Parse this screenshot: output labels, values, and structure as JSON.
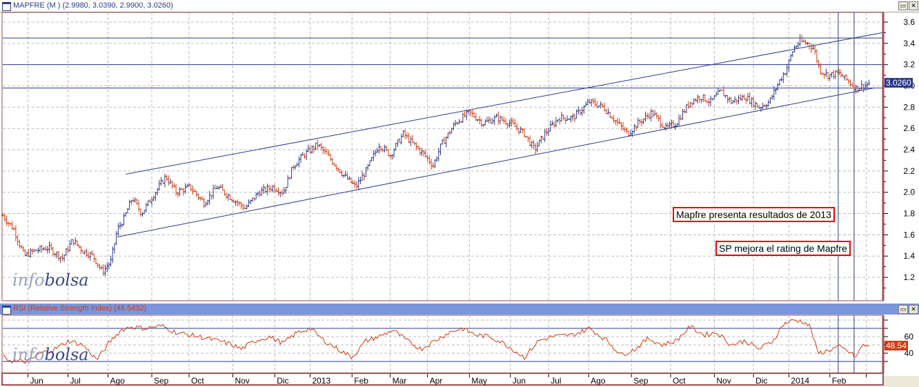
{
  "main_panel": {
    "title": "MAPFRE (M ) (2.9980, 3.0390, 2.9900, 3.0260)",
    "last_price_label": "3.0260",
    "watermark_a": "info",
    "watermark_b": "bolsa"
  },
  "rsi_panel": {
    "title": "RSI (Relative Strength Index) (48.5432)",
    "last_value_label": "48.54"
  },
  "annotations": [
    "Mapfre presenta resultados de 2013",
    "SP mejora el rating de Mapfre"
  ],
  "colors": {
    "up": "#2a3a8c",
    "down": "#d03a10",
    "lines": "#2a3a8c",
    "rsi": "#d03a10",
    "rsi_header": "#7b96dc"
  },
  "chart_data": [
    {
      "type": "line",
      "title": "MAPFRE (M )",
      "ohlc_last": {
        "open": 2.998,
        "high": 3.039,
        "low": 2.99,
        "close": 3.026
      },
      "x_unit": "weeks",
      "ylim": [
        1.1,
        3.7
      ],
      "y_ticks": [
        1.2,
        1.4,
        1.6,
        1.8,
        2.0,
        2.2,
        2.4,
        2.6,
        2.8,
        3.0,
        3.2,
        3.4,
        3.6
      ],
      "x_ticks": [
        {
          "label": "Jun",
          "x": 2.7
        },
        {
          "label": "Jul",
          "x": 7
        },
        {
          "label": "Ago",
          "x": 11.3
        },
        {
          "label": "Sep",
          "x": 16
        },
        {
          "label": "Oct",
          "x": 20
        },
        {
          "label": "Nov",
          "x": 24.7
        },
        {
          "label": "Dic",
          "x": 29.2
        },
        {
          "label": "2013",
          "x": 33
        },
        {
          "label": "Feb",
          "x": 37.5
        },
        {
          "label": "Mar",
          "x": 41.6
        },
        {
          "label": "Apr",
          "x": 45.6
        },
        {
          "label": "May",
          "x": 50.1
        },
        {
          "label": "Jun",
          "x": 54.5
        },
        {
          "label": "Jul",
          "x": 58.6
        },
        {
          "label": "Ago",
          "x": 62.9
        },
        {
          "label": "Sep",
          "x": 67.5
        },
        {
          "label": "Oct",
          "x": 71.7
        },
        {
          "label": "Nov",
          "x": 76.4
        },
        {
          "label": "Dic",
          "x": 80.6
        },
        {
          "label": "2014",
          "x": 84.4
        },
        {
          "label": "Feb",
          "x": 88.8
        },
        {
          "label": "",
          "x": 92.7
        }
      ],
      "close": [
        [
          0,
          1.78
        ],
        [
          1.2,
          1.65
        ],
        [
          2.3,
          1.4
        ],
        [
          3.4,
          1.45
        ],
        [
          4.9,
          1.48
        ],
        [
          6.4,
          1.38
        ],
        [
          7.5,
          1.55
        ],
        [
          8.6,
          1.45
        ],
        [
          9.7,
          1.4
        ],
        [
          10.7,
          1.25
        ],
        [
          11.6,
          1.35
        ],
        [
          12.3,
          1.65
        ],
        [
          13,
          1.75
        ],
        [
          13.9,
          1.95
        ],
        [
          14.9,
          1.8
        ],
        [
          16,
          1.95
        ],
        [
          17.5,
          2.15
        ],
        [
          18.6,
          2.0
        ],
        [
          20.1,
          2.05
        ],
        [
          21.6,
          1.9
        ],
        [
          23,
          2.05
        ],
        [
          24.5,
          1.95
        ],
        [
          26,
          1.85
        ],
        [
          27.5,
          2.0
        ],
        [
          29,
          2.05
        ],
        [
          30.1,
          2.0
        ],
        [
          31.2,
          2.25
        ],
        [
          32.3,
          2.35
        ],
        [
          33.8,
          2.45
        ],
        [
          35.3,
          2.3
        ],
        [
          36.7,
          2.15
        ],
        [
          37.9,
          2.05
        ],
        [
          39,
          2.2
        ],
        [
          40.4,
          2.45
        ],
        [
          41.6,
          2.35
        ],
        [
          43,
          2.55
        ],
        [
          44.1,
          2.45
        ],
        [
          45.3,
          2.35
        ],
        [
          46.2,
          2.25
        ],
        [
          47.1,
          2.45
        ],
        [
          48.6,
          2.65
        ],
        [
          50.1,
          2.75
        ],
        [
          51.6,
          2.65
        ],
        [
          53,
          2.7
        ],
        [
          54.5,
          2.65
        ],
        [
          56,
          2.55
        ],
        [
          57.1,
          2.4
        ],
        [
          58.2,
          2.55
        ],
        [
          59.7,
          2.7
        ],
        [
          61.2,
          2.7
        ],
        [
          63,
          2.85
        ],
        [
          64.5,
          2.8
        ],
        [
          66,
          2.65
        ],
        [
          67.1,
          2.55
        ],
        [
          68.2,
          2.65
        ],
        [
          69.7,
          2.75
        ],
        [
          71.2,
          2.6
        ],
        [
          72.3,
          2.65
        ],
        [
          73.8,
          2.85
        ],
        [
          74.9,
          2.9
        ],
        [
          76,
          2.85
        ],
        [
          77.1,
          2.95
        ],
        [
          78.2,
          2.85
        ],
        [
          79.7,
          2.9
        ],
        [
          81.2,
          2.8
        ],
        [
          82.3,
          2.85
        ],
        [
          83.4,
          3.05
        ],
        [
          84.1,
          3.15
        ],
        [
          84.9,
          3.35
        ],
        [
          85.6,
          3.42
        ],
        [
          86.4,
          3.4
        ],
        [
          87.1,
          3.35
        ],
        [
          87.7,
          3.15
        ],
        [
          88.6,
          3.1
        ],
        [
          89.7,
          3.12
        ],
        [
          90.7,
          3.05
        ],
        [
          91.6,
          2.98
        ],
        [
          92.3,
          3.0
        ],
        [
          93.2,
          3.026
        ]
      ],
      "horizontal_levels": [
        3.45,
        3.2,
        2.98
      ],
      "channel_upper": [
        [
          13.2,
          2.17
        ],
        [
          94.4,
          3.5
        ]
      ],
      "channel_lower": [
        [
          12.3,
          1.58
        ],
        [
          93.5,
          2.98
        ]
      ],
      "event_markers_x": [
        89.7,
        91.4
      ]
    },
    {
      "type": "line",
      "title": "RSI (Relative Strength Index)",
      "ylim": [
        20,
        85
      ],
      "y_ticks": [
        40,
        60
      ],
      "levels": [
        30,
        70
      ],
      "values": [
        [
          0,
          35
        ],
        [
          1.2,
          30
        ],
        [
          2.7,
          30
        ],
        [
          4.1,
          40
        ],
        [
          5.6,
          45
        ],
        [
          7.1,
          55
        ],
        [
          8.6,
          50
        ],
        [
          10.1,
          32
        ],
        [
          11.6,
          55
        ],
        [
          12.7,
          68
        ],
        [
          13.8,
          72
        ],
        [
          15.3,
          70
        ],
        [
          17.1,
          73
        ],
        [
          18.6,
          65
        ],
        [
          20.1,
          62
        ],
        [
          21.9,
          58
        ],
        [
          24.2,
          52
        ],
        [
          25.6,
          45
        ],
        [
          27.1,
          55
        ],
        [
          28.6,
          60
        ],
        [
          30.1,
          52
        ],
        [
          31.6,
          65
        ],
        [
          33,
          70
        ],
        [
          34.5,
          55
        ],
        [
          36,
          45
        ],
        [
          37.5,
          35
        ],
        [
          39,
          55
        ],
        [
          40.4,
          60
        ],
        [
          41.9,
          68
        ],
        [
          43.4,
          55
        ],
        [
          44.9,
          45
        ],
        [
          46.4,
          55
        ],
        [
          47.9,
          65
        ],
        [
          49.3,
          70
        ],
        [
          50.8,
          62
        ],
        [
          52.3,
          60
        ],
        [
          53.8,
          52
        ],
        [
          56,
          35
        ],
        [
          57.5,
          55
        ],
        [
          59,
          60
        ],
        [
          61.2,
          62
        ],
        [
          63,
          70
        ],
        [
          64.9,
          55
        ],
        [
          66.4,
          38
        ],
        [
          67.9,
          45
        ],
        [
          69.3,
          58
        ],
        [
          70.8,
          50
        ],
        [
          72.3,
          55
        ],
        [
          73.8,
          72
        ],
        [
          75.3,
          62
        ],
        [
          76.7,
          65
        ],
        [
          78.2,
          50
        ],
        [
          79.7,
          55
        ],
        [
          81.2,
          45
        ],
        [
          82.7,
          55
        ],
        [
          83.8,
          75
        ],
        [
          84.9,
          80
        ],
        [
          86,
          78
        ],
        [
          86.7,
          72
        ],
        [
          87.5,
          40
        ],
        [
          88.6,
          43
        ],
        [
          89.7,
          48
        ],
        [
          90.8,
          42
        ],
        [
          91.6,
          35
        ],
        [
          92.3,
          50
        ],
        [
          93.2,
          48.54
        ]
      ]
    }
  ]
}
